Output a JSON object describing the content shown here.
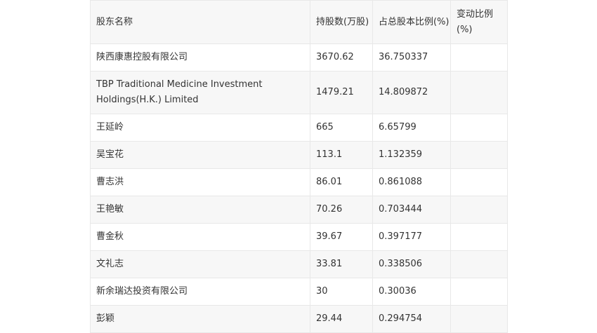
{
  "table": {
    "headers": [
      "股东名称",
      "持股数(万股)",
      "占总股本比例(%)",
      "变动比例(%)"
    ],
    "rows": [
      {
        "name": "陕西康惠控股有限公司",
        "shares": "3670.62",
        "ratio": "36.750337",
        "change": ""
      },
      {
        "name": "TBP Traditional Medicine Investment Holdings(H.K.) Limited",
        "shares": "1479.21",
        "ratio": "14.809872",
        "change": ""
      },
      {
        "name": "王延岭",
        "shares": "665",
        "ratio": "6.65799",
        "change": ""
      },
      {
        "name": "吴宝花",
        "shares": "113.1",
        "ratio": "1.132359",
        "change": ""
      },
      {
        "name": "曹志洪",
        "shares": "86.01",
        "ratio": "0.861088",
        "change": ""
      },
      {
        "name": "王艳敏",
        "shares": "70.26",
        "ratio": "0.703444",
        "change": ""
      },
      {
        "name": "曹金秋",
        "shares": "39.67",
        "ratio": "0.397177",
        "change": ""
      },
      {
        "name": "文礼志",
        "shares": "33.81",
        "ratio": "0.338506",
        "change": ""
      },
      {
        "name": "新余瑞达投资有限公司",
        "shares": "30",
        "ratio": "0.30036",
        "change": ""
      },
      {
        "name": "彭颖",
        "shares": "29.44",
        "ratio": "0.294754",
        "change": ""
      }
    ]
  }
}
